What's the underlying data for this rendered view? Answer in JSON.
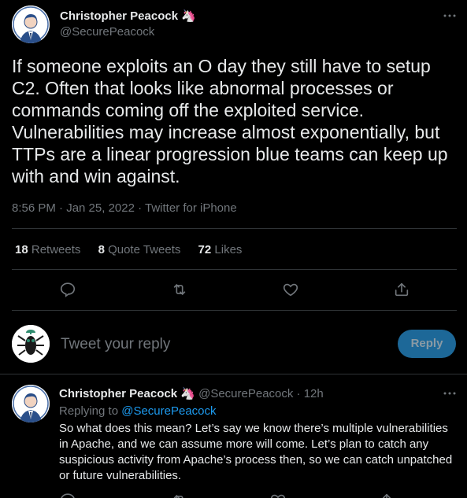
{
  "main_tweet": {
    "author_name": "Christopher Peacock",
    "author_emoji": "🦄",
    "handle": "@SecurePeacock",
    "text": "If someone exploits an O day they still have to setup C2. Often that looks like abnormal processes or commands coming off the exploited service. Vulnerabilities may increase almost exponentially, but TTPs are a linear progression blue teams can keep up with and win against.",
    "meta": "8:56 PM · Jan 25, 2022 · Twitter for iPhone",
    "stats": {
      "retweets_count": "18",
      "retweets_label": "Retweets",
      "quotes_count": "8",
      "quotes_label": "Quote Tweets",
      "likes_count": "72",
      "likes_label": "Likes"
    },
    "actions": [
      "reply-icon",
      "retweet-icon",
      "like-icon",
      "share-icon"
    ]
  },
  "reply_composer": {
    "placeholder": "Tweet your reply",
    "button_label": "Reply"
  },
  "reply_tweet": {
    "author_name": "Christopher Peacock",
    "author_emoji": "🦄",
    "handle_time": "@SecurePeacock · 12h",
    "replying_prefix": "Replying to",
    "replying_to": "@SecurePeacock",
    "text": "So what does this mean? Let’s say we know there’s multiple vulnerabilities in Apache, and we can assume more will come. Let’s plan to catch any suspicious activity from Apache’s process then, so we can catch unpatched or future vulnerabilities."
  },
  "colors": {
    "background": "#000000",
    "text_primary": "#e7e9ea",
    "text_secondary": "#71767b",
    "link": "#1d9bf0",
    "divider": "#2f3336",
    "reply_button_bg": "#1d6898"
  }
}
